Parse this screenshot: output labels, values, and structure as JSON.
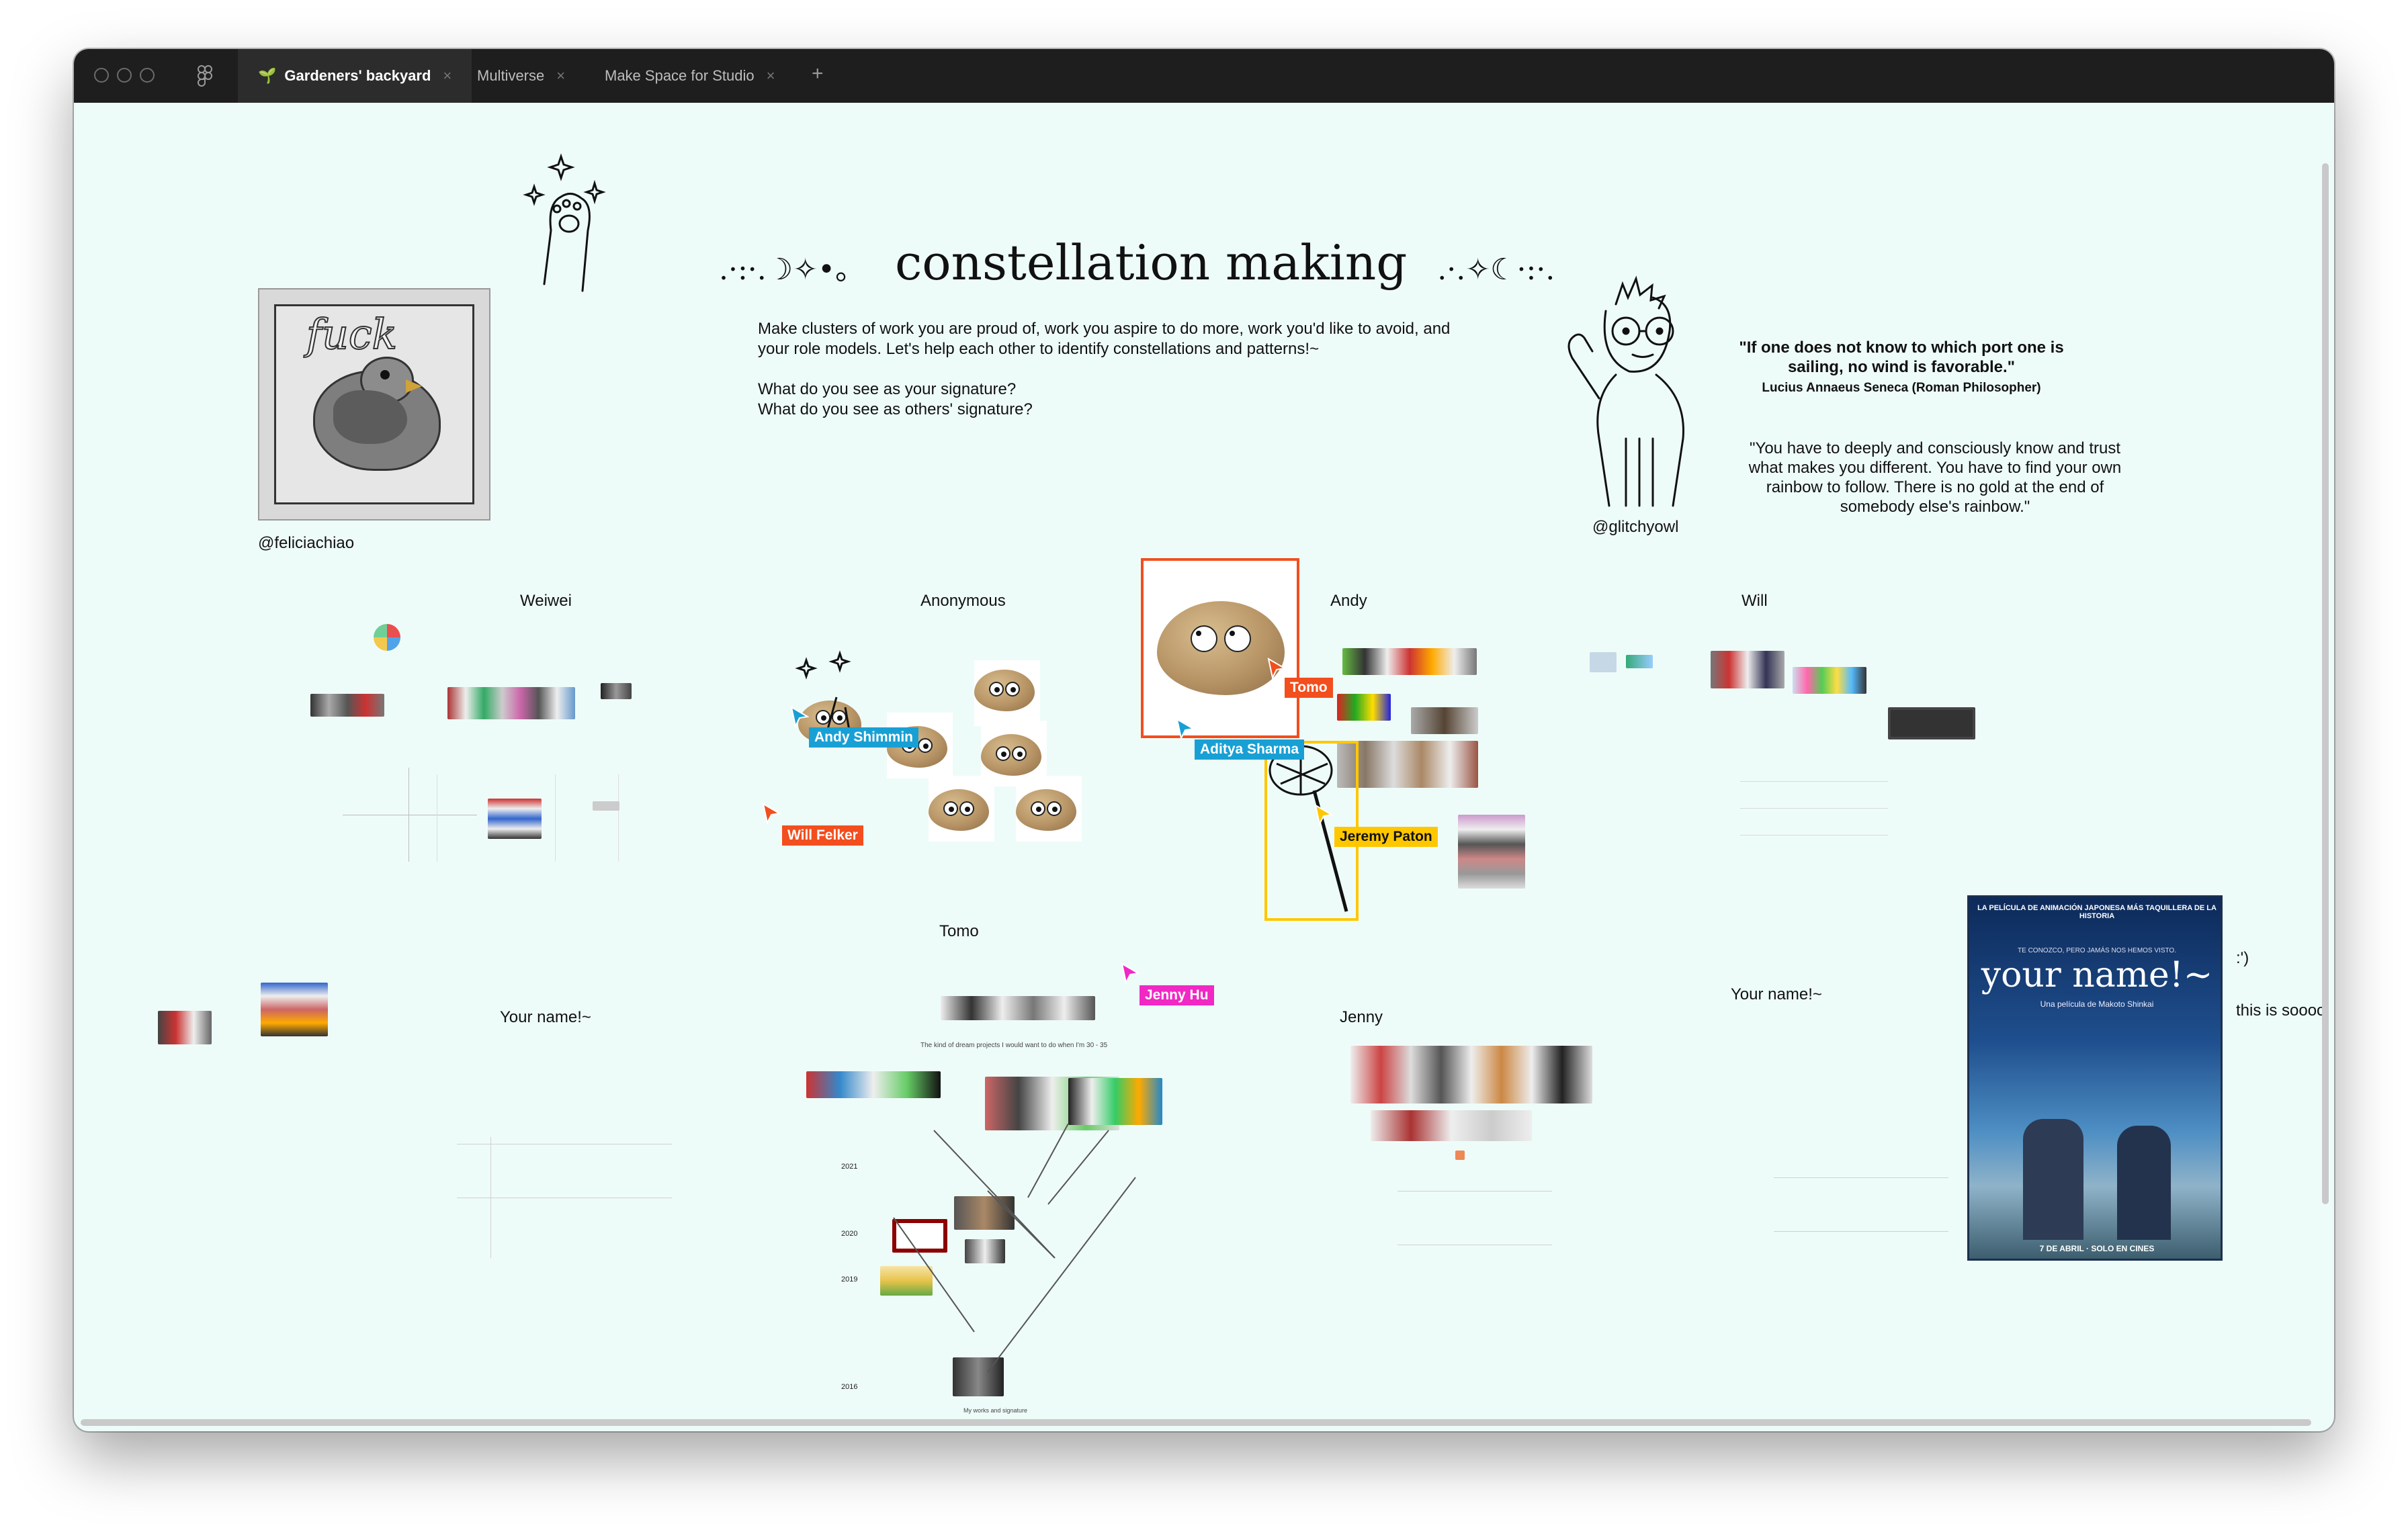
{
  "titlebar": {
    "tabs": [
      {
        "label": "Gardeners' backyard",
        "active": true
      },
      {
        "label": "Multiverse",
        "active": false
      },
      {
        "label": "Make Space for Studio",
        "active": false
      }
    ],
    "close_glyph": "×",
    "new_tab_glyph": "+"
  },
  "board": {
    "title_left_deco": ".·:·.☽✧•。",
    "title": "constellation making",
    "title_right_deco": ".·.✧☾·:·.",
    "intro": "Make clusters of work you are proud of, work you aspire to do more, work you'd like to avoid, and your role models. Let's help each other to identify constellations and patterns!~",
    "question1": "What do you see as your signature?",
    "question2": "What do you see as others' signature?",
    "left_handle": "@feliciachiao",
    "sticker_word": "fuck",
    "right_handle": "@glitchyowl",
    "quote1_text": "\"If one does not know to which port one is sailing, no wind is favorable.\"",
    "quote1_author": "Lucius Annaeus Seneca (Roman Philosopher)",
    "quote2": "\"You have to deeply and consciously know and trust what makes you different. You have to find your own rainbow to follow. There is no gold at the end of somebody else's rainbow.\"",
    "side_note1": ":')",
    "side_note2": "this is soooo"
  },
  "sections": {
    "weiwei": "Weiwei",
    "anonymous": "Anonymous",
    "andy": "Andy",
    "will": "Will",
    "tomo": "Tomo",
    "your_name_left": "Your name!~",
    "jenny": "Jenny",
    "your_name_right": "Your name!~"
  },
  "tomo_section": {
    "caption": "The kind of dream projects I would want to do when I'm 30 - 35",
    "years": [
      "2021",
      "2020",
      "2019",
      "2016"
    ],
    "footer": "My works and signature"
  },
  "cursors": [
    {
      "name": "Tomo",
      "color": "#f24e1e"
    },
    {
      "name": "Andy Shimmin",
      "color": "#18a0d5"
    },
    {
      "name": "Aditya Sharma",
      "color": "#18a0d5"
    },
    {
      "name": "Will Felker",
      "color": "#f24e1e"
    },
    {
      "name": "Jeremy Paton",
      "color": "#ffc700"
    },
    {
      "name": "Jenny Hu",
      "color": "#f028c4"
    }
  ],
  "poster": {
    "top_line": "LA PELÍCULA DE ANIMACIÓN JAPONESA MÁS TAQUILLERA DE LA HISTORIA",
    "tagline": "TE CONOZCO, PERO JAMÁS NOS HEMOS VISTO.",
    "title": "your name!~",
    "subtitle": "Una película de Makoto Shinkai",
    "release": "7 DE ABRIL · SOLO EN CINES"
  },
  "colors": {
    "canvas_bg": "#eefcf9",
    "titlebar_bg": "#1e1e1e",
    "selection_orange": "#f24e1e",
    "selection_yellow": "#ffc700"
  }
}
